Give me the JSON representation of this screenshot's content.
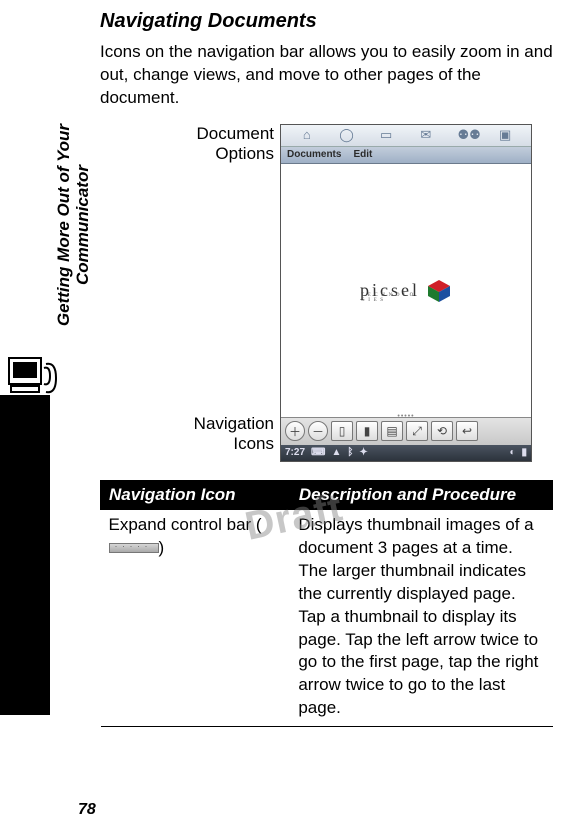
{
  "heading": "Navigating Documents",
  "intro": "Icons on the navigation bar allows you to easily zoom in and out, change views, and move to other pages of the document.",
  "figure": {
    "label_document_options": "Document\nOptions",
    "label_navigation_icons": "Navigation\nIcons",
    "menubar": {
      "m1": "Documents",
      "m2": "Edit"
    },
    "picsel": {
      "brand": "picsel",
      "sub": "T E C H N O L O G I E S"
    },
    "status_time": "7:27"
  },
  "side_label_line1": "Getting More Out of Your",
  "side_label_line2": "Communicator",
  "watermark": "Draft",
  "table": {
    "header_icon": "Navigation Icon",
    "header_desc": "Description and Procedure",
    "row1_icon": "Expand control bar",
    "row1_desc": "Displays thumbnail images of a document 3 pages at a time. The larger thumbnail indicates the currently displayed page. Tap a thumbnail to display its page. Tap the left arrow twice to go to the first page, tap the right arrow twice to go to the last page."
  },
  "page_number": "78"
}
